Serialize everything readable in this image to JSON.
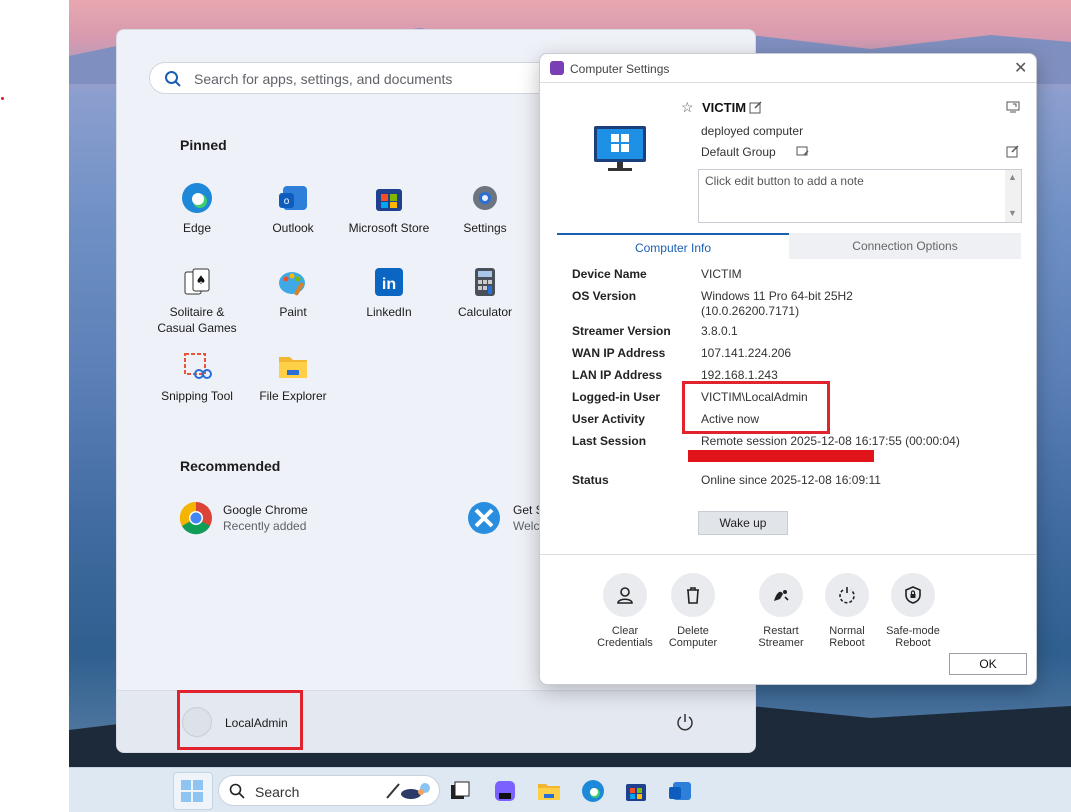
{
  "start_menu": {
    "search_placeholder": "Search for apps, settings, and documents",
    "pinned_title": "Pinned",
    "pinned_apps": [
      {
        "label": "Edge",
        "icon": "edge-icon"
      },
      {
        "label": "Outlook",
        "icon": "outlook-icon"
      },
      {
        "label": "Microsoft Store",
        "icon": "store-icon"
      },
      {
        "label": "Settings",
        "icon": "gear-icon"
      },
      {
        "label": "Solitaire &",
        "label2": "Casual Games",
        "icon": "cards-icon"
      },
      {
        "label": "Paint",
        "icon": "paint-icon"
      },
      {
        "label": "LinkedIn",
        "icon": "linkedin-icon"
      },
      {
        "label": "Calculator",
        "icon": "calculator-icon"
      },
      {
        "label": "Snipping Tool",
        "icon": "scissors-icon"
      },
      {
        "label": "File Explorer",
        "icon": "folder-icon"
      }
    ],
    "recommended_title": "Recommended",
    "recommended": [
      {
        "title": "Google Chrome",
        "subtitle": "Recently added"
      },
      {
        "title": "Get S",
        "subtitle": "Welc"
      }
    ],
    "user_name": "LocalAdmin"
  },
  "dialog": {
    "title": "Computer Settings",
    "device_name": "VICTIM",
    "description": "deployed computer",
    "group": "Default Group",
    "note_placeholder": "Click edit button to add a note",
    "tabs": [
      "Computer Info",
      "Connection Options"
    ],
    "info": [
      {
        "label": "Device Name",
        "value": "VICTIM"
      },
      {
        "label": "OS Version",
        "value": "Windows 11 Pro 64-bit 25H2",
        "value2": "(10.0.26200.7171)"
      },
      {
        "label": "Streamer Version",
        "value": "3.8.0.1"
      },
      {
        "label": "WAN IP Address",
        "value": "107.141.224.206"
      },
      {
        "label": "LAN IP Address",
        "value": "192.168.1.243"
      },
      {
        "label": "Logged-in User",
        "value": "VICTIM\\LocalAdmin"
      },
      {
        "label": "User Activity",
        "value": "Active now"
      },
      {
        "label": "Last Session",
        "value": "Remote session 2025-12-08 16:17:55 (00:00:04)"
      },
      {
        "label": "Status",
        "value": "Online since 2025-12-08 16:09:11"
      }
    ],
    "wake_button": "Wake up",
    "actions": [
      {
        "line1": "Clear",
        "line2": "Credentials",
        "icon": "user-icon"
      },
      {
        "line1": "Delete",
        "line2": "Computer",
        "icon": "trash-icon"
      },
      {
        "line1": "Restart",
        "line2": "Streamer",
        "icon": "restart-streamer-icon"
      },
      {
        "line1": "Normal",
        "line2": "Reboot",
        "icon": "reboot-icon"
      },
      {
        "line1": "Safe-mode",
        "line2": "Reboot",
        "icon": "shield-lock-icon"
      }
    ],
    "ok_button": "OK"
  },
  "taskbar": {
    "search_label": "Search"
  },
  "colors": {
    "accent": "#1a5fb4",
    "highlight": "#e1232d"
  }
}
